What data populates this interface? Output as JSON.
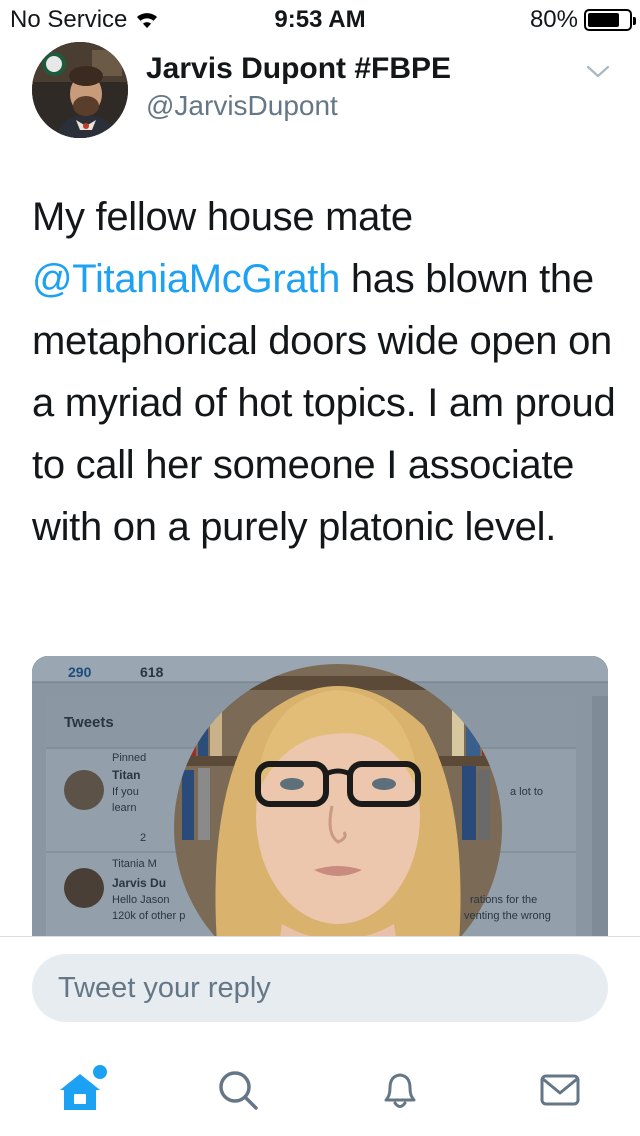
{
  "status_bar": {
    "carrier": "No Service",
    "time": "9:53 AM",
    "battery_text": "80%",
    "battery_level": 0.8
  },
  "tweet": {
    "display_name": "Jarvis Dupont #FBPE",
    "handle": "@JarvisDupont",
    "text_before": "My fellow house mate ",
    "mention": "@TitaniaMcGrath",
    "text_after": " has blown the metaphorical doors wide open on a myriad of hot topics. I am proud to call her someone I associate with on a purely platonic level."
  },
  "media": {
    "tweets_count": "290",
    "following_count": "618",
    "tab_label": "Tweets",
    "pinned_label": "Pinned",
    "row1_name": "Titan",
    "row1_line1": "If you",
    "row1_line2": "learn",
    "row1_right": "a lot to",
    "reply_count": "2",
    "retweet_label": "Titania M",
    "row2_name": "Jarvis Du",
    "row2_line1": "Hello Jason",
    "row2_line2": "120k of other p",
    "row2_right1": "rations for the",
    "row2_right2": "venting the wrong"
  },
  "reply": {
    "placeholder": "Tweet your reply"
  },
  "tab_bar": {
    "items": [
      "home-icon",
      "search-icon",
      "notifications-icon",
      "messages-icon"
    ],
    "accent": "#1da1f2",
    "inactive": "#657786"
  }
}
